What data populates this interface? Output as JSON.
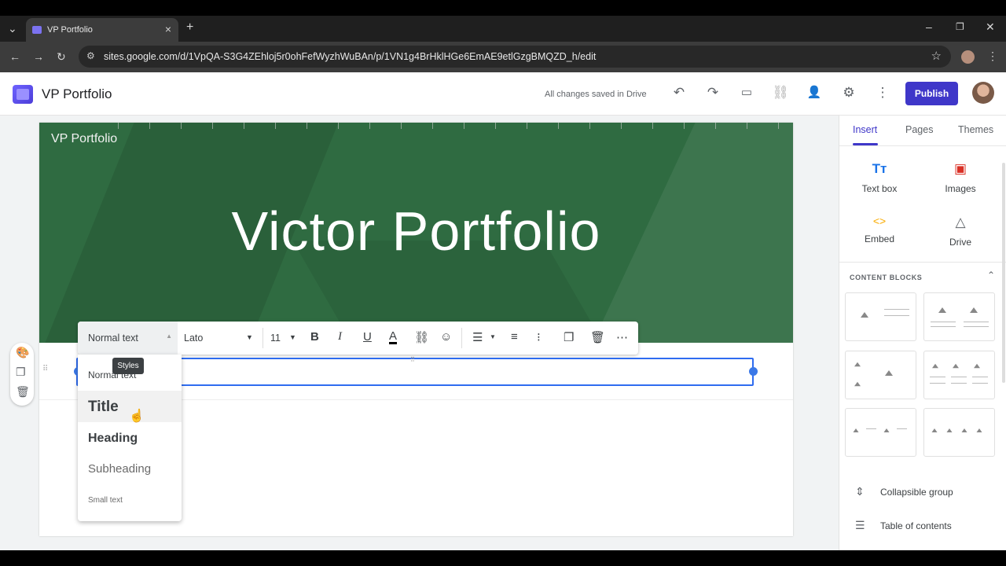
{
  "browser": {
    "tab_title": "VP Portfolio",
    "tab_close": "×",
    "new_tab": "+",
    "url": "sites.google.com/d/1VpQA-S3G4ZEhloj5r0ohFefWyzhWuBAn/p/1VN1g4BrHklHGe6EmAE9etlGzgBMQZD_h/edit"
  },
  "header": {
    "title": "VP Portfolio",
    "saved_status": "All changes saved in Drive",
    "publish_label": "Publish"
  },
  "canvas": {
    "site_name": "VP Portfolio",
    "banner_title": "Victor Portfolio"
  },
  "toolbar": {
    "style_value": "Normal text",
    "font_value": "Lato",
    "size_value": "11",
    "tooltip": "Styles"
  },
  "style_menu": {
    "items": [
      "Normal text",
      "Title",
      "Heading",
      "Subheading",
      "Small text"
    ]
  },
  "panel": {
    "tabs": [
      "Insert",
      "Pages",
      "Themes"
    ],
    "insert_items": [
      "Text box",
      "Images",
      "Embed",
      "Drive"
    ],
    "content_blocks_label": "CONTENT BLOCKS",
    "bottom_items": [
      "Collapsible group",
      "Table of contents"
    ]
  },
  "colors": {
    "accent": "#3f37c9",
    "banner": "#2f6b41",
    "selection": "#2f6cf0"
  }
}
